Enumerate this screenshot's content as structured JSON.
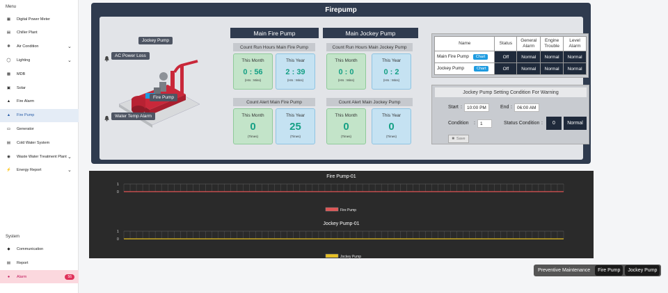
{
  "sidebar": {
    "menu_heading": "Menu",
    "system_heading": "System",
    "items": [
      {
        "label": "Digital Power Meter",
        "icon": "power-meter-icon",
        "chevron": false
      },
      {
        "label": "Chiller Plant",
        "icon": "chiller-icon",
        "chevron": false
      },
      {
        "label": "Air Condition",
        "icon": "fan-icon",
        "chevron": true
      },
      {
        "label": "Lighting",
        "icon": "bulb-icon",
        "chevron": true
      },
      {
        "label": "MDB",
        "icon": "mdb-icon",
        "chevron": false
      },
      {
        "label": "Solar",
        "icon": "solar-icon",
        "chevron": false
      },
      {
        "label": "Fire Alarm",
        "icon": "fire-alarm-icon",
        "chevron": false
      },
      {
        "label": "Fire Pump",
        "icon": "fire-pump-icon",
        "chevron": false
      },
      {
        "label": "Generator",
        "icon": "generator-icon",
        "chevron": false
      },
      {
        "label": "Cold Water System",
        "icon": "cold-water-icon",
        "chevron": false
      },
      {
        "label": "Waste Water Treatment Plant",
        "icon": "waste-water-icon",
        "chevron": true
      },
      {
        "label": "Energy Report",
        "icon": "energy-report-icon",
        "chevron": true
      }
    ],
    "system_items": [
      {
        "label": "Communication",
        "icon": "communication-icon"
      },
      {
        "label": "Report",
        "icon": "report-icon"
      },
      {
        "label": "Alarm",
        "icon": "bell-icon",
        "badge": "56"
      }
    ],
    "active_item": "Fire Pump"
  },
  "panel": {
    "title": "Firepump",
    "tags": {
      "jockey": "Jockey Pump",
      "ac_power": "AC Power Loss",
      "fire_pump": "Fire Pump",
      "water_temp": "Water Temp Alarm"
    },
    "main": {
      "header": "Main Fire Pump",
      "run_header": "Count Run Hours Main Fire Pump",
      "alert_header": "Count Alert Main Fire Pump",
      "run_month": {
        "title": "This Month",
        "value": "0 : 56",
        "unit": "(Hrs : Mins)"
      },
      "run_year": {
        "title": "This Year",
        "value": "2 : 39",
        "unit": "(Hrs : Mins)"
      },
      "alert_month": {
        "title": "This Month",
        "value": "0",
        "unit": "(Times)"
      },
      "alert_year": {
        "title": "This Year",
        "value": "25",
        "unit": "(Times)"
      }
    },
    "jockey": {
      "header": "Main Jockey Pump",
      "run_header": "Count Run Hours Main Jockey Pump",
      "alert_header": "Count Alert Main Jockey Pump",
      "run_month": {
        "title": "This Month",
        "value": "0 : 0",
        "unit": "(Hrs : Mins)"
      },
      "run_year": {
        "title": "This Year",
        "value": "0 : 2",
        "unit": "(Hrs : Mins)"
      },
      "alert_month": {
        "title": "This Month",
        "value": "0",
        "unit": "(Times)"
      },
      "alert_year": {
        "title": "This Year",
        "value": "0",
        "unit": "(Times)"
      }
    },
    "status_table": {
      "headers": [
        "Name",
        "Status",
        "General Alarm",
        "Engine Trouble",
        "Level Alarm"
      ],
      "chart_label": "Chart",
      "rows": [
        {
          "name": "Main Fire Pump",
          "status": "Off",
          "general": "Normal",
          "engine": "Normal",
          "level": "Normal"
        },
        {
          "name": "Jockey Pump",
          "status": "Off",
          "general": "Normal",
          "engine": "Normal",
          "level": "Normal"
        }
      ]
    },
    "setting": {
      "title": "Jockey Pump Setting Condition For Warning",
      "start_label": "Start",
      "start_value": "10:00 PM",
      "end_label": "End",
      "end_value": "06:00 AM",
      "condition_label": "Condition",
      "condition_value": "1",
      "status_condition_label": "Status Condition",
      "status_condition_value": "0",
      "status_condition_state": "Normal",
      "save_label": "Save",
      "colon": ":"
    }
  },
  "trends": [
    {
      "title": "Fire Pump-01",
      "legend": "Fire Pump",
      "color": "#e05555",
      "y_ticks": [
        "1",
        "0"
      ],
      "values_zero": true
    },
    {
      "title": "Jockey Pump-01",
      "legend": "Jockey Pump",
      "color": "#e8c020",
      "y_ticks": [
        "1",
        "0"
      ],
      "values_zero": true
    }
  ],
  "bottom_buttons": {
    "preventive": "Preventive Maintenance",
    "fire_pump": "Fire Pump",
    "jockey_pump": "Jockey Pump"
  },
  "colors": {
    "panel_dark": "#2f3b4f",
    "value_green": "#16a085",
    "chart_button": "#1e9be0",
    "alarm_badge": "#e0315a"
  }
}
